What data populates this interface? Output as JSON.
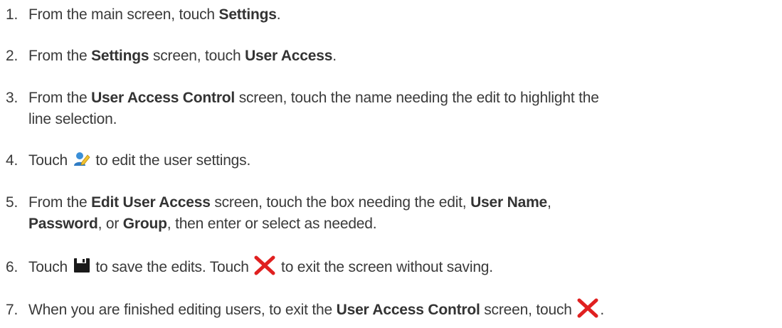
{
  "steps": [
    {
      "num": "1.",
      "t1": "From the main screen, touch ",
      "b1": "Settings",
      "t2": "."
    },
    {
      "num": "2.",
      "t1": "From the ",
      "b1": "Settings",
      "t2": " screen, touch ",
      "b2": "User Access",
      "t3": "."
    },
    {
      "num": "3.",
      "t1": "From the ",
      "b1": "User Access Control",
      "t2": " screen, touch the name needing the edit to highlight the",
      "t3": "line selection."
    },
    {
      "num": "4.",
      "t1": "Touch ",
      "icon": "edit-user-icon",
      "t2": " to edit the user settings."
    },
    {
      "num": "5.",
      "t1": "From the ",
      "b1": "Edit User Access",
      "t2": " screen, touch the box needing the edit, ",
      "b2": "User Name",
      "t3": ",",
      "b3": "Password",
      "t4": ", or ",
      "b4": "Group",
      "t5": ", then enter or select as needed."
    },
    {
      "num": "6.",
      "t1": "Touch ",
      "icon1": "save-icon",
      "t2": " to save the edits. Touch ",
      "icon2": "close-icon",
      "t3": " to exit the screen without saving."
    },
    {
      "num": "7.",
      "t1": "When you are finished editing users, to exit the ",
      "b1": "User Access Control",
      "t2": " screen, touch ",
      "icon": "close-icon",
      "t3": "."
    }
  ],
  "colors": {
    "text": "#3a3a3a",
    "close_icon": "#e02020",
    "save_icon": "#1a1a1a",
    "edit_icon": "#3a8fd8"
  }
}
